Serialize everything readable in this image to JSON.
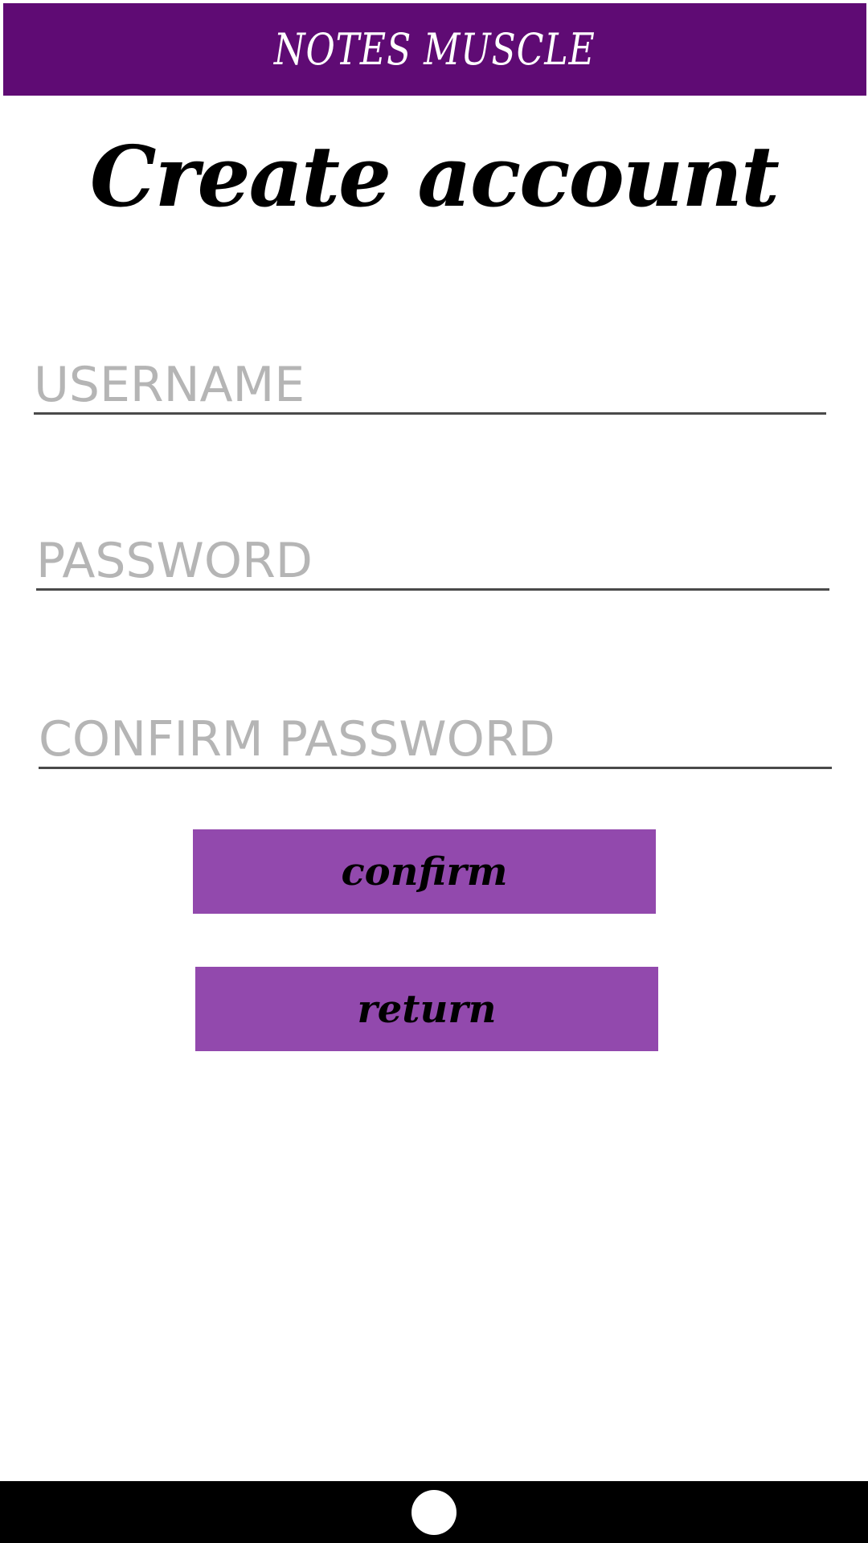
{
  "app_bar": {
    "title": "NOTES MUSCLE",
    "color": "#5f0b74"
  },
  "page": {
    "title": "Create account"
  },
  "form": {
    "username": {
      "placeholder": "USERNAME",
      "value": ""
    },
    "password": {
      "placeholder": "PASSWORD",
      "value": ""
    },
    "confirm_password": {
      "placeholder": "CONFIRM PASSWORD",
      "value": ""
    }
  },
  "buttons": {
    "confirm_label": "confirm",
    "return_label": "return",
    "color": "#9249ad"
  },
  "nav_bar": {
    "home_icon": "home-circle-icon"
  }
}
